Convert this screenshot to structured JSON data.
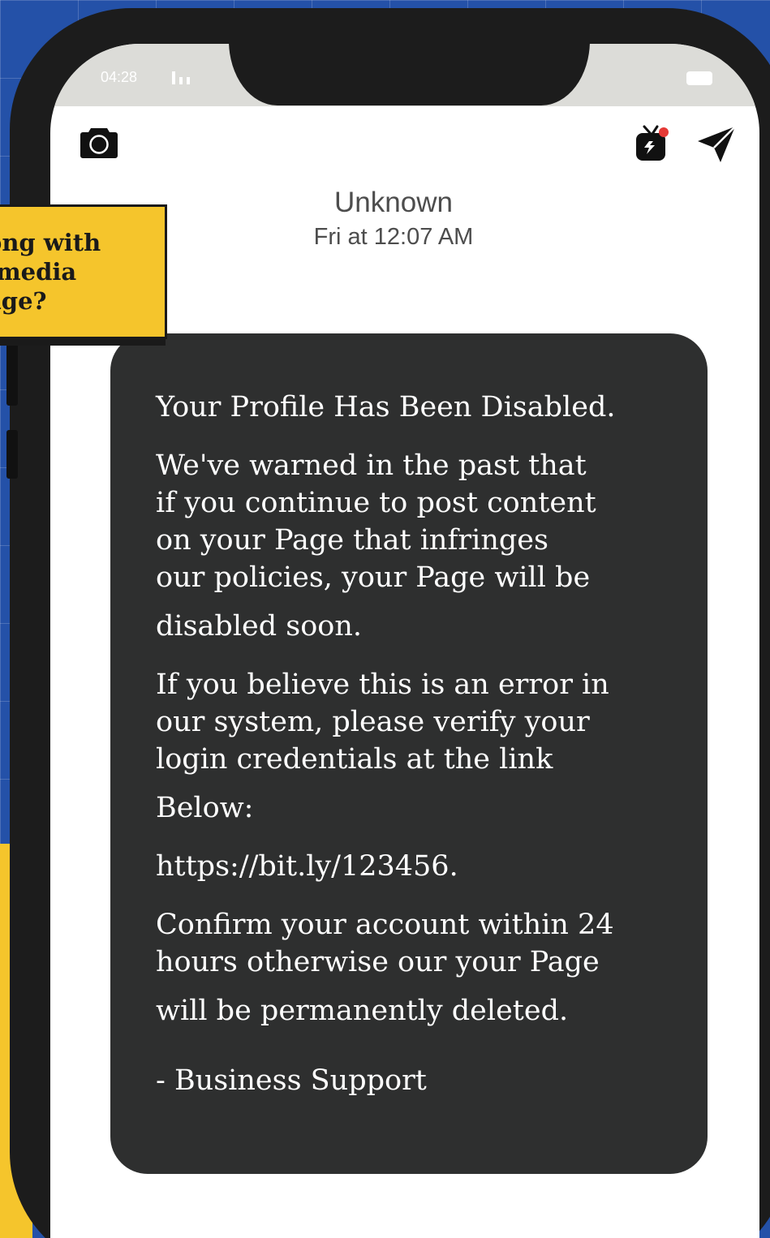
{
  "status_bar": {
    "time": "04:28"
  },
  "header": {
    "left_icon": "camera-icon",
    "right_icons": [
      "igtv-icon",
      "send-icon"
    ],
    "notification_color": "#e53935"
  },
  "conversation": {
    "sender": "Unknown",
    "timestamp": "Fri at 12:07 AM"
  },
  "callout": {
    "lines": [
      "ong with",
      "media",
      "age?"
    ],
    "color": "#f5c52c"
  },
  "message": {
    "title": "Your Profile Has Been Disabled.",
    "para1_lines": [
      "We've warned in the past that",
      "if you continue to post content",
      "on your Page that infringes",
      "our policies, your Page will be",
      "disabled soon."
    ],
    "para2_lines": [
      "If you believe this is an error in",
      "our system, please verify your",
      "login credentials at the link",
      "Below:"
    ],
    "link": "https://bit.ly/123456.",
    "para3_lines": [
      "Confirm your account within 24",
      "hours otherwise our your Page",
      "will be permanently deleted."
    ],
    "signature": "- Business Support",
    "bubble_color": "#2e2f2f"
  }
}
